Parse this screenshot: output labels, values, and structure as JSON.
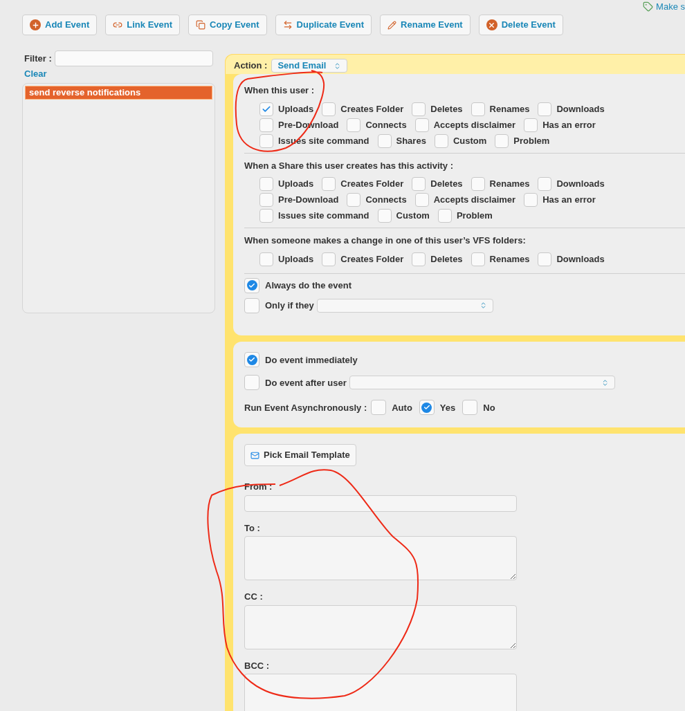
{
  "top_link": {
    "label": "Make s"
  },
  "toolbar": [
    {
      "label": "Add Event",
      "kind": "add"
    },
    {
      "label": "Link Event",
      "kind": "link"
    },
    {
      "label": "Copy Event",
      "kind": "copy"
    },
    {
      "label": "Duplicate Event",
      "kind": "duplicate"
    },
    {
      "label": "Rename Event",
      "kind": "rename"
    },
    {
      "label": "Delete Event",
      "kind": "delete"
    }
  ],
  "filter": {
    "label": "Filter :",
    "clear": "Clear"
  },
  "event_list": [
    {
      "label": "send reverse notifications",
      "selected": true
    }
  ],
  "action": {
    "label": "Action :",
    "value": "Send Email"
  },
  "trigger_groups": [
    {
      "heading": "When this user :",
      "lines": [
        [
          {
            "label": "Uploads",
            "checked": true
          },
          {
            "label": "Creates Folder",
            "checked": false
          },
          {
            "label": "Deletes",
            "checked": false
          },
          {
            "label": "Renames",
            "checked": false
          },
          {
            "label": "Downloads",
            "checked": false
          }
        ],
        [
          {
            "label": "Pre-Download",
            "checked": false
          },
          {
            "label": "Connects",
            "checked": false
          },
          {
            "label": "Accepts disclaimer",
            "checked": false
          },
          {
            "label": "Has an error",
            "checked": false
          }
        ],
        [
          {
            "label": "Issues site command",
            "checked": false
          },
          {
            "label": "Shares",
            "checked": false
          },
          {
            "label": "Custom",
            "checked": false
          },
          {
            "label": "Problem",
            "checked": false
          }
        ]
      ]
    },
    {
      "heading": "When a Share this user creates has this activity :",
      "lines": [
        [
          {
            "label": "Uploads",
            "checked": false
          },
          {
            "label": "Creates Folder",
            "checked": false
          },
          {
            "label": "Deletes",
            "checked": false
          },
          {
            "label": "Renames",
            "checked": false
          },
          {
            "label": "Downloads",
            "checked": false
          }
        ],
        [
          {
            "label": "Pre-Download",
            "checked": false
          },
          {
            "label": "Connects",
            "checked": false
          },
          {
            "label": "Accepts disclaimer",
            "checked": false
          },
          {
            "label": "Has an error",
            "checked": false
          }
        ],
        [
          {
            "label": "Issues site command",
            "checked": false
          },
          {
            "label": "Custom",
            "checked": false
          },
          {
            "label": "Problem",
            "checked": false
          }
        ]
      ]
    },
    {
      "heading": "When someone makes a change in one of this user’s VFS folders:",
      "lines": [
        [
          {
            "label": "Uploads",
            "checked": false
          },
          {
            "label": "Creates Folder",
            "checked": false
          },
          {
            "label": "Deletes",
            "checked": false
          },
          {
            "label": "Renames",
            "checked": false
          },
          {
            "label": "Downloads",
            "checked": false
          }
        ]
      ]
    }
  ],
  "conditions": [
    {
      "label": "Always do the event",
      "checked": true,
      "kind": "plain"
    },
    {
      "label": "Only if they",
      "checked": false,
      "kind": "select"
    }
  ],
  "timing": [
    {
      "label": "Do event immediately",
      "checked": true,
      "kind": "plain"
    },
    {
      "label": "Do event after user",
      "checked": false,
      "kind": "select"
    }
  ],
  "async": {
    "label": "Run Event Asynchronously :",
    "options": [
      {
        "label": "Auto",
        "checked": false
      },
      {
        "label": "Yes",
        "checked": true
      },
      {
        "label": "No",
        "checked": false
      }
    ]
  },
  "template_button": {
    "label": "Pick Email Template"
  },
  "email_fields": [
    {
      "label": "From :",
      "kind": "input"
    },
    {
      "label": "To :",
      "kind": "textarea"
    },
    {
      "label": "CC :",
      "kind": "textarea"
    },
    {
      "label": "BCC :",
      "kind": "textarea"
    }
  ]
}
